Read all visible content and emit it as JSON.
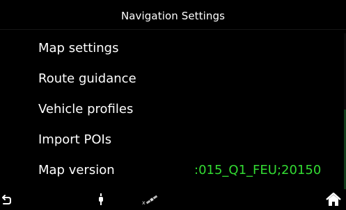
{
  "header": {
    "title": "Navigation Settings"
  },
  "menu": {
    "items": [
      {
        "label": "Map settings"
      },
      {
        "label": "Route guidance"
      },
      {
        "label": "Vehicle profiles"
      },
      {
        "label": "Import POIs"
      },
      {
        "label": "Map version",
        "value": ":015_Q1_FEU;20150"
      }
    ]
  },
  "bottom_bar": {
    "icons": [
      "back-icon",
      "location-pin-icon",
      "satellite-icon",
      "home-icon"
    ]
  },
  "colors": {
    "background": "#000000",
    "text": "#ffffff",
    "value_text": "#33dd33"
  }
}
